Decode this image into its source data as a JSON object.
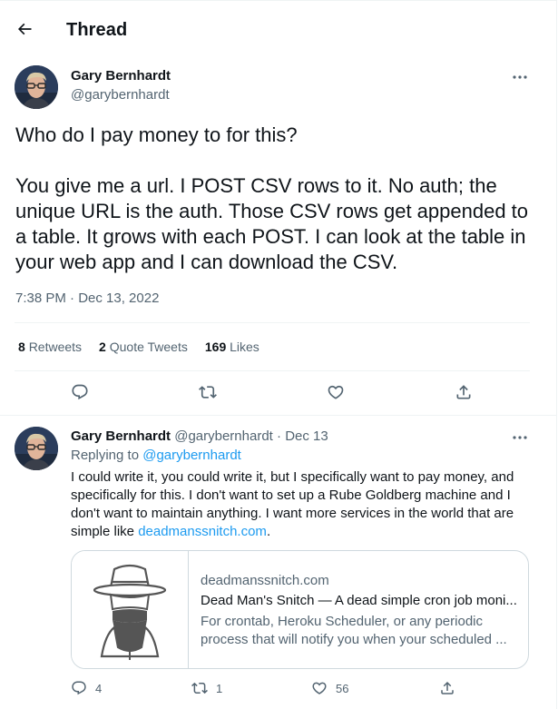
{
  "header": {
    "title": "Thread",
    "back_icon": "arrow-left-icon"
  },
  "main_tweet": {
    "author_name": "Gary Bernhardt",
    "author_handle": "@garybernhardt",
    "text": "Who do I pay money to for this?\n\nYou give me a url. I POST CSV rows to it. No auth; the unique URL is the auth. Those CSV rows get appended to a table. It grows with each POST. I can look at the table in your web app and I can download the CSV.",
    "timestamp": "7:38 PM · Dec 13, 2022",
    "stats": {
      "retweets_count": "8",
      "retweets_label": "Retweets",
      "quotes_count": "2",
      "quotes_label": "Quote Tweets",
      "likes_count": "169",
      "likes_label": "Likes"
    }
  },
  "reply": {
    "author_name": "Gary Bernhardt",
    "author_handle": "@garybernhardt",
    "separator": "·",
    "date": "Dec 13",
    "replying_prefix": "Replying to",
    "replying_handle": "@garybernhardt",
    "text_before_link": "I could write it, you could write it, but I specifically want to pay money, and specifically for this. I don't want to set up a Rube Goldberg machine and I don't want to maintain anything. I want more services in the world that are simple like ",
    "text_link": "deadmanssnitch.com",
    "text_after_link": ".",
    "card": {
      "domain": "deadmanssnitch.com",
      "title": "Dead Man's Snitch — A dead simple cron job moni...",
      "desc_line1": "For crontab, Heroku Scheduler, or any periodic",
      "desc_line2": "process that will notify you when your scheduled ..."
    },
    "actions": {
      "replies": "4",
      "retweets": "1",
      "likes": "56"
    }
  },
  "colors": {
    "accent": "#1d9bf0",
    "muted": "#536471",
    "text": "#0f1419",
    "border": "#eff3f4"
  }
}
